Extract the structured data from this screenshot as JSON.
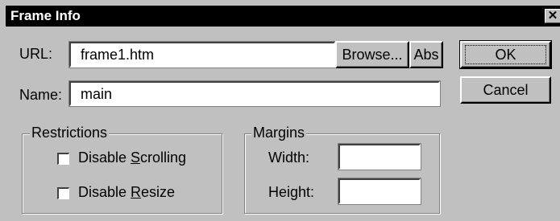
{
  "dialog": {
    "title": "Frame Info",
    "close_icon": "close-icon"
  },
  "url": {
    "label": "URL:",
    "value": "frame1.htm",
    "browse_label": "Browse...",
    "abs_label": "Abs"
  },
  "name": {
    "label": "Name:",
    "value": "main"
  },
  "buttons": {
    "ok": "OK",
    "cancel": "Cancel"
  },
  "restrictions": {
    "legend": "Restrictions",
    "disable_scrolling": {
      "prefix": "Disable ",
      "accel": "S",
      "suffix": "crolling",
      "checked": false
    },
    "disable_resize": {
      "prefix": "Disable ",
      "accel": "R",
      "suffix": "esize",
      "checked": false
    }
  },
  "margins": {
    "legend": "Margins",
    "width_label": "Width:",
    "width_value": "",
    "height_label": "Height:",
    "height_value": ""
  }
}
